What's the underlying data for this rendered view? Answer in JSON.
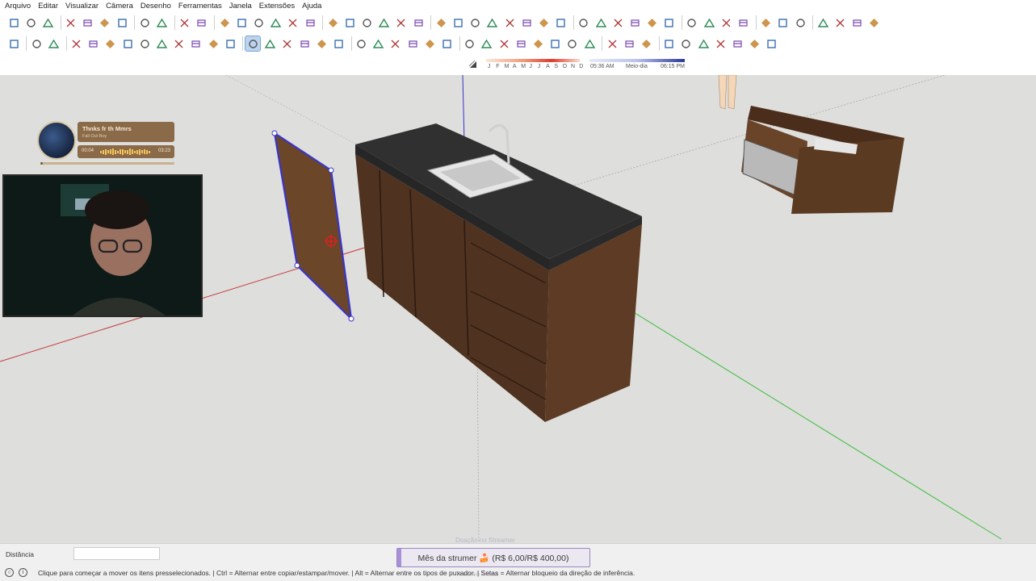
{
  "menu": [
    "Arquivo",
    "Editar",
    "Visualizar",
    "Câmera",
    "Desenho",
    "Ferramentas",
    "Janela",
    "Extensões",
    "Ajuda"
  ],
  "toolbar_row1": [
    "new-file",
    "open-file",
    "save",
    "cut",
    "copy",
    "paste",
    "erase",
    "undo",
    "redo",
    "print",
    "model-info",
    "iso-view",
    "top-view",
    "front-view",
    "right-view",
    "back-view",
    "left-view",
    "xray",
    "wireframe",
    "hidden-line",
    "shaded",
    "textured",
    "monochrome",
    "group",
    "component",
    "component-options",
    "solid-union",
    "solid-subtract",
    "solid-intersect",
    "solid-trim",
    "solid-split",
    "outer-shell",
    "entity-info",
    "zoom-extents",
    "orbit",
    "pan",
    "walk",
    "look-around",
    "position-camera",
    "section-plane",
    "section-display",
    "section-cuts",
    "styles",
    "warehouse",
    "extension-warehouse",
    "layers",
    "outliner",
    "account"
  ],
  "toolbar_row2": [
    "select",
    "paint-bucket",
    "eraser",
    "line",
    "freehand",
    "rectangle",
    "rotated-rectangle",
    "circle",
    "polygon",
    "arc",
    "two-point-arc",
    "three-point-arc",
    "pie",
    "move",
    "push-pull",
    "rotate",
    "follow-me",
    "scale",
    "offset",
    "tape-measure",
    "dimension",
    "protractor",
    "text",
    "axes",
    "3d-text",
    "orbit",
    "pan",
    "zoom",
    "zoom-window",
    "zoom-extents",
    "previous",
    "next",
    "position-camera",
    "look-around",
    "walk",
    "section",
    "sandbox-from-contours",
    "sandbox-from-scratch",
    "smoove",
    "stamp",
    "drape",
    "add-detail",
    "flip-edge"
  ],
  "toolbar_active": [
    "move"
  ],
  "shadows": {
    "months": [
      "J",
      "F",
      "M",
      "A",
      "M",
      "J",
      "J",
      "A",
      "S",
      "O",
      "N",
      "D"
    ],
    "time_start": "05:36 AM",
    "time_mid": "Meio-dia",
    "time_end": "06:15 PM"
  },
  "music": {
    "title": "Thnks fr th Mmrs",
    "artist": "Fall Out Boy",
    "elapsed": "00:04",
    "duration": "03:23",
    "progress": 0.02
  },
  "statusbar": {
    "distance_label": "Distância",
    "distance_value": "",
    "goal": "Mês da strumer 🍰 (R$ 6,00/R$ 400,00)",
    "goal_ghost": "Doação no Streamer",
    "goal_ghost2": "Texto no Alerta",
    "hint": "Clique para começar a mover os itens presselecionados. | Ctrl = Alternar entre copiar/estampar/mover. | Alt = Alternar entre os tipos de puxador. | Setas = Alternar bloqueio da direção de inferência."
  },
  "colors": {
    "accent_purple": "#9a87c0",
    "axis_red": "#c43c3c",
    "axis_green": "#3fbf3f",
    "axis_blue": "#3333cc",
    "wood": "#5a3a22",
    "granite": "#2e2e2e"
  }
}
